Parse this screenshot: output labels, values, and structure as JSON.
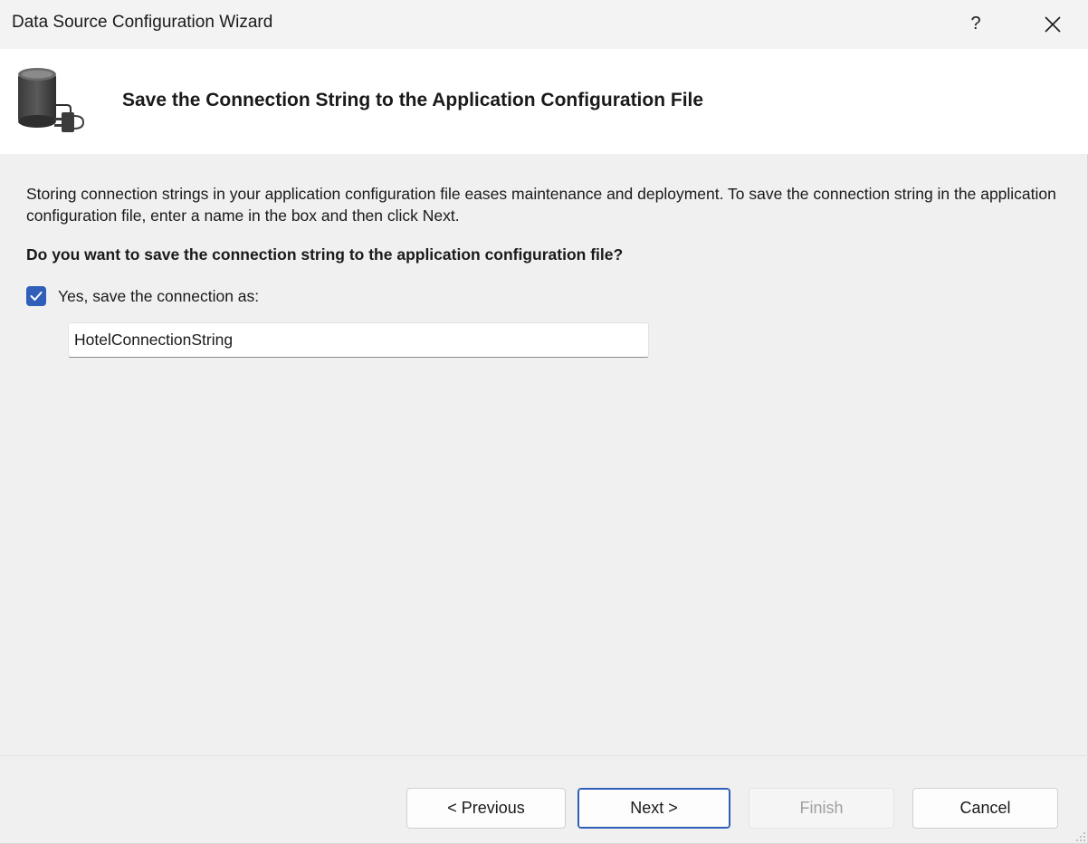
{
  "window": {
    "title": "Data Source Configuration Wizard",
    "help_label": "?"
  },
  "header": {
    "title": "Save the Connection String to the Application Configuration File",
    "icon": "database-connection-icon"
  },
  "content": {
    "description": "Storing connection strings in your application configuration file eases maintenance and deployment. To save the connection string in the application configuration file, enter a name in the box and then click Next.",
    "question": "Do you want to save the connection string to the application configuration file?",
    "save_checkbox": {
      "label": "Yes, save the connection as:",
      "checked": true
    },
    "connection_name": {
      "value": "HotelConnectionString"
    }
  },
  "footer": {
    "previous_label": "< Previous",
    "next_label": "Next >",
    "finish_label": "Finish",
    "cancel_label": "Cancel",
    "finish_enabled": false
  },
  "colors": {
    "accent": "#2f5fb8",
    "dialog_background": "#f0f0f0",
    "header_background": "#ffffff",
    "disabled_text": "#a0a0a0"
  }
}
